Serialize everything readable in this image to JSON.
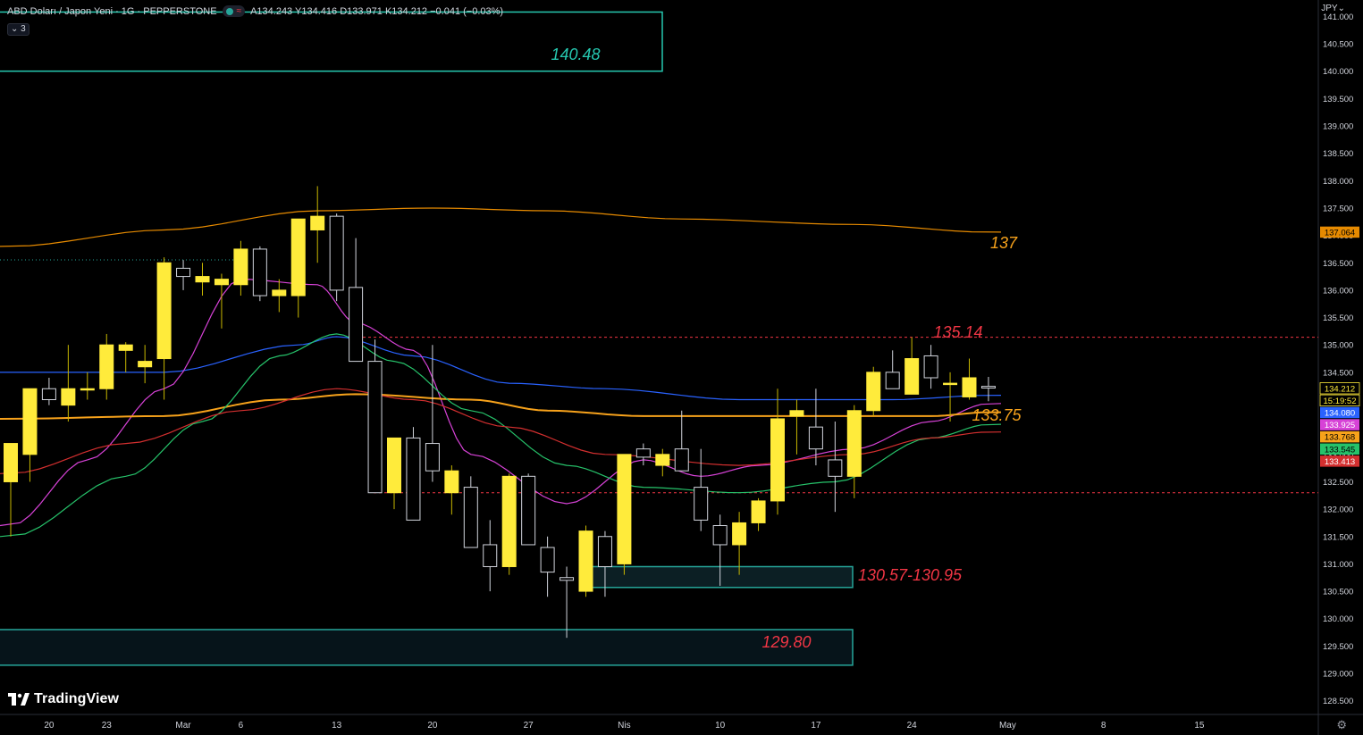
{
  "header": {
    "title": "ABD Doları / Japon Yeni · 1G · PEPPERSTONE",
    "ohlc": "A134.243  Y134.416  D133.971  K134.212  −0.041 (−0.03%)",
    "indicator_toggle": "3"
  },
  "currency": "JPY",
  "brand": "TradingView",
  "colors": {
    "background": "#000000",
    "up_candle": "#ffeb3b",
    "down_candle": "#000000",
    "wick": "#d1d4dc",
    "text": "#d1d4dc",
    "teal": "#26a69a",
    "orange": "#f7a21b",
    "red": "#f23645"
  },
  "chart_data": {
    "type": "candlestick",
    "symbol": "USDJPY",
    "timeframe": "1D",
    "ylim": [
      128.25,
      141.3
    ],
    "y_ticks": [
      "128.500",
      "129.000",
      "129.500",
      "130.000",
      "130.500",
      "131.000",
      "131.500",
      "132.000",
      "132.500",
      "133.000",
      "133.500",
      "134.000",
      "134.500",
      "135.000",
      "135.500",
      "136.000",
      "136.500",
      "137.000",
      "137.500",
      "138.000",
      "138.500",
      "139.000",
      "139.500",
      "140.000",
      "140.500",
      "141.000"
    ],
    "x_ticks": [
      {
        "label": "20",
        "date": "2023-02-20"
      },
      {
        "label": "23",
        "date": "2023-02-23"
      },
      {
        "label": "Mar",
        "date": "2023-03-01"
      },
      {
        "label": "6",
        "date": "2023-03-06"
      },
      {
        "label": "13",
        "date": "2023-03-13"
      },
      {
        "label": "20",
        "date": "2023-03-20"
      },
      {
        "label": "27",
        "date": "2023-03-27"
      },
      {
        "label": "Nis",
        "date": "2023-04-03"
      },
      {
        "label": "10",
        "date": "2023-04-10"
      },
      {
        "label": "17",
        "date": "2023-04-17"
      },
      {
        "label": "24",
        "date": "2023-04-24"
      },
      {
        "label": "May",
        "date": "2023-05-01"
      },
      {
        "label": "8",
        "date": "2023-05-08"
      },
      {
        "label": "15",
        "date": "2023-05-15"
      }
    ],
    "candles": [
      {
        "d": "2023-02-16",
        "o": 132.5,
        "h": 133.1,
        "l": 131.5,
        "c": 133.2
      },
      {
        "d": "2023-02-17",
        "o": 133.0,
        "h": 134.0,
        "l": 132.5,
        "c": 134.2
      },
      {
        "d": "2023-02-20",
        "o": 134.2,
        "h": 134.4,
        "l": 133.9,
        "c": 134.0
      },
      {
        "d": "2023-02-21",
        "o": 133.9,
        "h": 135.0,
        "l": 133.6,
        "c": 134.2
      },
      {
        "d": "2023-02-22",
        "o": 134.2,
        "h": 134.5,
        "l": 134.0,
        "c": 134.2
      },
      {
        "d": "2023-02-23",
        "o": 134.2,
        "h": 135.2,
        "l": 134.0,
        "c": 135.0
      },
      {
        "d": "2023-02-24",
        "o": 134.9,
        "h": 135.05,
        "l": 134.5,
        "c": 135.0
      },
      {
        "d": "2023-02-27",
        "o": 134.6,
        "h": 135.0,
        "l": 134.3,
        "c": 134.7
      },
      {
        "d": "2023-02-28",
        "o": 134.75,
        "h": 136.6,
        "l": 134.0,
        "c": 136.5
      },
      {
        "d": "2023-03-01",
        "o": 136.4,
        "h": 136.55,
        "l": 136.0,
        "c": 136.25
      },
      {
        "d": "2023-03-02",
        "o": 136.15,
        "h": 136.5,
        "l": 135.9,
        "c": 136.25
      },
      {
        "d": "2023-03-03",
        "o": 136.1,
        "h": 136.3,
        "l": 135.3,
        "c": 136.2
      },
      {
        "d": "2023-03-06",
        "o": 136.1,
        "h": 136.9,
        "l": 135.9,
        "c": 136.75
      },
      {
        "d": "2023-03-07",
        "o": 136.75,
        "h": 136.8,
        "l": 135.8,
        "c": 135.9
      },
      {
        "d": "2023-03-08",
        "o": 135.9,
        "h": 136.2,
        "l": 135.6,
        "c": 136.0
      },
      {
        "d": "2023-03-09",
        "o": 135.9,
        "h": 137.2,
        "l": 135.5,
        "c": 137.3
      },
      {
        "d": "2023-03-10",
        "o": 137.1,
        "h": 137.9,
        "l": 136.5,
        "c": 137.35
      },
      {
        "d": "2023-03-13",
        "o": 137.35,
        "h": 137.4,
        "l": 135.8,
        "c": 136.0
      },
      {
        "d": "2023-03-14",
        "o": 136.05,
        "h": 136.95,
        "l": 134.7,
        "c": 134.7
      },
      {
        "d": "2023-03-15",
        "o": 134.7,
        "h": 135.1,
        "l": 132.3,
        "c": 132.3
      },
      {
        "d": "2023-03-16",
        "o": 132.3,
        "h": 133.2,
        "l": 132.0,
        "c": 133.3
      },
      {
        "d": "2023-03-17",
        "o": 133.3,
        "h": 133.5,
        "l": 131.8,
        "c": 131.8
      },
      {
        "d": "2023-03-20",
        "o": 133.2,
        "h": 135.0,
        "l": 132.5,
        "c": 132.7
      },
      {
        "d": "2023-03-21",
        "o": 132.3,
        "h": 132.8,
        "l": 131.9,
        "c": 132.7
      },
      {
        "d": "2023-03-22",
        "o": 132.4,
        "h": 132.6,
        "l": 131.7,
        "c": 131.3
      },
      {
        "d": "2023-03-23",
        "o": 131.35,
        "h": 131.8,
        "l": 130.5,
        "c": 130.95
      },
      {
        "d": "2023-03-24",
        "o": 130.95,
        "h": 132.65,
        "l": 130.8,
        "c": 132.6
      },
      {
        "d": "2023-03-27",
        "o": 132.6,
        "h": 132.65,
        "l": 131.6,
        "c": 131.35
      },
      {
        "d": "2023-03-28",
        "o": 131.3,
        "h": 131.5,
        "l": 130.4,
        "c": 130.85
      },
      {
        "d": "2023-03-29",
        "o": 130.75,
        "h": 130.95,
        "l": 129.65,
        "c": 130.7
      },
      {
        "d": "2023-03-30",
        "o": 130.5,
        "h": 131.7,
        "l": 130.4,
        "c": 131.6
      },
      {
        "d": "2023-03-31",
        "o": 131.5,
        "h": 131.6,
        "l": 130.4,
        "c": 130.95
      },
      {
        "d": "2023-04-03",
        "o": 131.0,
        "h": 133.0,
        "l": 130.8,
        "c": 133.0
      },
      {
        "d": "2023-04-04",
        "o": 133.1,
        "h": 133.2,
        "l": 132.8,
        "c": 132.95
      },
      {
        "d": "2023-04-05",
        "o": 132.8,
        "h": 133.1,
        "l": 132.6,
        "c": 133.0
      },
      {
        "d": "2023-04-06",
        "o": 133.1,
        "h": 133.8,
        "l": 132.7,
        "c": 132.7
      },
      {
        "d": "2023-04-07",
        "o": 132.4,
        "h": 133.1,
        "l": 131.6,
        "c": 131.8
      },
      {
        "d": "2023-04-10",
        "o": 131.7,
        "h": 131.9,
        "l": 130.6,
        "c": 131.35
      },
      {
        "d": "2023-04-11",
        "o": 131.35,
        "h": 131.95,
        "l": 130.8,
        "c": 131.75
      },
      {
        "d": "2023-04-12",
        "o": 131.75,
        "h": 132.2,
        "l": 131.6,
        "c": 132.15
      },
      {
        "d": "2023-04-13",
        "o": 132.15,
        "h": 134.2,
        "l": 131.9,
        "c": 133.65
      },
      {
        "d": "2023-04-14",
        "o": 133.7,
        "h": 134.0,
        "l": 133.0,
        "c": 133.8
      },
      {
        "d": "2023-04-17",
        "o": 133.5,
        "h": 134.2,
        "l": 132.8,
        "c": 133.1
      },
      {
        "d": "2023-04-18",
        "o": 132.9,
        "h": 133.6,
        "l": 131.95,
        "c": 132.6
      },
      {
        "d": "2023-04-19",
        "o": 132.6,
        "h": 133.9,
        "l": 132.2,
        "c": 133.8
      },
      {
        "d": "2023-04-20",
        "o": 133.8,
        "h": 134.6,
        "l": 133.7,
        "c": 134.5
      },
      {
        "d": "2023-04-21",
        "o": 134.5,
        "h": 134.9,
        "l": 134.2,
        "c": 134.2
      },
      {
        "d": "2023-04-24",
        "o": 134.1,
        "h": 135.14,
        "l": 134.1,
        "c": 134.75
      },
      {
        "d": "2023-04-25",
        "o": 134.8,
        "h": 135.0,
        "l": 134.2,
        "c": 134.4
      },
      {
        "d": "2023-04-26",
        "o": 134.3,
        "h": 134.5,
        "l": 133.6,
        "c": 134.3
      },
      {
        "d": "2023-04-27",
        "o": 134.05,
        "h": 134.75,
        "l": 134.0,
        "c": 134.4
      },
      {
        "d": "2023-04-28",
        "o": 134.243,
        "h": 134.416,
        "l": 133.971,
        "c": 134.212
      }
    ],
    "moving_averages": [
      {
        "color": "#2962ff",
        "last": 134.08,
        "values": [
          [
            0,
            134.5
          ],
          [
            8,
            134.5
          ],
          [
            15,
            135.0
          ],
          [
            17,
            135.15
          ],
          [
            21,
            134.8
          ],
          [
            26,
            134.3
          ],
          [
            31,
            134.2
          ],
          [
            38,
            134.0
          ],
          [
            46,
            134.0
          ],
          [
            51,
            134.08
          ]
        ]
      },
      {
        "color": "#d742d7",
        "last": 133.925,
        "values": [
          [
            0,
            131.7
          ],
          [
            4,
            132.9
          ],
          [
            8,
            134.2
          ],
          [
            12,
            136.2
          ],
          [
            16,
            136.1
          ],
          [
            18,
            135.4
          ],
          [
            21,
            134.9
          ],
          [
            24,
            133.0
          ],
          [
            29,
            132.1
          ],
          [
            33,
            132.9
          ],
          [
            36,
            132.6
          ],
          [
            39,
            132.8
          ],
          [
            44,
            133.1
          ],
          [
            48,
            133.6
          ],
          [
            51,
            133.93
          ]
        ]
      },
      {
        "color": "#f7a21b",
        "last": 133.768,
        "values": [
          [
            0,
            133.65
          ],
          [
            8,
            133.7
          ],
          [
            14,
            134.0
          ],
          [
            18,
            134.1
          ],
          [
            24,
            134.0
          ],
          [
            28,
            133.8
          ],
          [
            33,
            133.7
          ],
          [
            38,
            133.7
          ],
          [
            48,
            133.7
          ],
          [
            51,
            133.77
          ]
        ]
      },
      {
        "color": "#26c26a",
        "last": 133.545,
        "values": [
          [
            0,
            131.5
          ],
          [
            6,
            132.6
          ],
          [
            10,
            133.6
          ],
          [
            14,
            134.8
          ],
          [
            17,
            135.2
          ],
          [
            20,
            134.7
          ],
          [
            24,
            133.8
          ],
          [
            29,
            132.8
          ],
          [
            33,
            132.4
          ],
          [
            38,
            132.3
          ],
          [
            43,
            132.5
          ],
          [
            48,
            133.3
          ],
          [
            51,
            133.55
          ]
        ]
      },
      {
        "color": "#d32f2f",
        "last": 133.413,
        "values": [
          [
            0,
            132.65
          ],
          [
            6,
            133.2
          ],
          [
            12,
            133.8
          ],
          [
            17,
            134.2
          ],
          [
            21,
            134.0
          ],
          [
            26,
            133.5
          ],
          [
            31,
            133.0
          ],
          [
            38,
            132.8
          ],
          [
            44,
            133.0
          ],
          [
            48,
            133.3
          ],
          [
            51,
            133.41
          ]
        ]
      },
      {
        "color": "#e68a00",
        "last": 137.064,
        "values": [
          [
            0,
            136.8
          ],
          [
            8,
            137.1
          ],
          [
            16,
            137.45
          ],
          [
            22,
            137.5
          ],
          [
            28,
            137.45
          ],
          [
            35,
            137.3
          ],
          [
            44,
            137.2
          ],
          [
            51,
            137.06
          ]
        ]
      }
    ],
    "annotations": [
      {
        "label": "140.48",
        "color": "#26c8b0",
        "zone": [
          140.0,
          141.08
        ]
      },
      {
        "label": "137",
        "color": "#f7a21b"
      },
      {
        "label": "135.14",
        "color": "#f23645",
        "level": 135.14
      },
      {
        "label": "133.75",
        "color": "#f7a21b"
      },
      {
        "label": "130.57-130.95",
        "color": "#f23645",
        "zone": [
          130.57,
          130.95
        ]
      },
      {
        "label": "129.80",
        "color": "#f23645",
        "zone": [
          129.15,
          129.8
        ]
      }
    ],
    "support_level": 132.3,
    "price_labels": [
      {
        "text": "137.064",
        "bg": "#e68a00",
        "fg": "#000000",
        "value": 137.064
      },
      {
        "text": "134.212",
        "bg": "#000000",
        "fg": "#ffeb3b",
        "value": 134.212,
        "border": "#ffeb3b"
      },
      {
        "text": "15:19:52",
        "bg": "#000000",
        "fg": "#ffeb3b",
        "value": 134.212,
        "border": "#ffeb3b",
        "second": true
      },
      {
        "text": "134.080",
        "bg": "#2962ff",
        "fg": "#ffffff",
        "value": 134.08
      },
      {
        "text": "133.925",
        "bg": "#d742d7",
        "fg": "#ffffff",
        "value": 133.925
      },
      {
        "text": "133.768",
        "bg": "#f7a21b",
        "fg": "#000000",
        "value": 133.768
      },
      {
        "text": "133.545",
        "bg": "#26c26a",
        "fg": "#000000",
        "value": 133.545
      },
      {
        "text": "133.413",
        "bg": "#d32f2f",
        "fg": "#ffffff",
        "value": 133.413
      }
    ]
  }
}
